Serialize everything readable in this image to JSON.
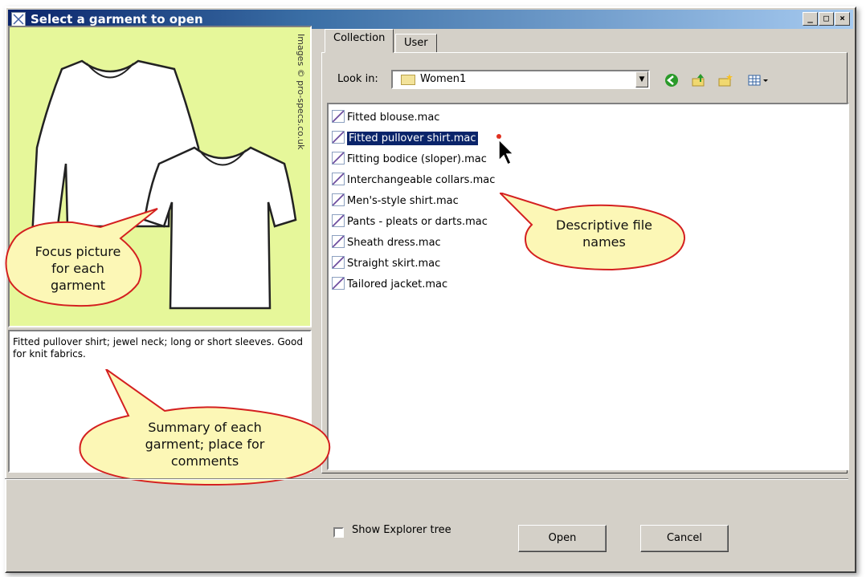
{
  "window": {
    "title": "Select a garment to open",
    "minimize": "_",
    "maximize": "□",
    "close": "×"
  },
  "focus_picture": {
    "credit": "Images © pro-specs.co.uk"
  },
  "summary": {
    "text": "Fitted pullover shirt; jewel neck; long or short sleeves.  Good for knit fabrics."
  },
  "tabs": [
    {
      "label": "Collection",
      "active": true
    },
    {
      "label": "User",
      "active": false
    }
  ],
  "look_in": {
    "label": "Look in:",
    "value": "Women1"
  },
  "toolbar": {
    "back_icon": "back-icon",
    "up_icon": "up-folder-icon",
    "new_folder_icon": "new-folder-icon",
    "view_icon": "view-menu-icon"
  },
  "files": [
    {
      "name": "Fitted blouse.mac",
      "selected": false
    },
    {
      "name": "Fitted pullover shirt.mac",
      "selected": true
    },
    {
      "name": "Fitting bodice (sloper).mac",
      "selected": false
    },
    {
      "name": "Interchangeable collars.mac",
      "selected": false
    },
    {
      "name": "Men's-style shirt.mac",
      "selected": false
    },
    {
      "name": "Pants - pleats or darts.mac",
      "selected": false
    },
    {
      "name": "Sheath dress.mac",
      "selected": false
    },
    {
      "name": "Straight skirt.mac",
      "selected": false
    },
    {
      "name": "Tailored jacket.mac",
      "selected": false
    }
  ],
  "callouts": {
    "focus": [
      "Focus picture",
      "for each",
      "garment"
    ],
    "files": [
      "Descriptive file",
      "names"
    ],
    "summary": [
      "Summary of each",
      "garment; place for",
      "comments"
    ]
  },
  "footer": {
    "show_explorer_label": "Show Explorer tree",
    "show_explorer_checked": false,
    "open_label": "Open",
    "cancel_label": "Cancel"
  },
  "colors": {
    "focus_background": "#e6f79a",
    "callout_fill": "#fcf7b6",
    "callout_stroke": "#d42020",
    "selection": "#0a246a"
  }
}
